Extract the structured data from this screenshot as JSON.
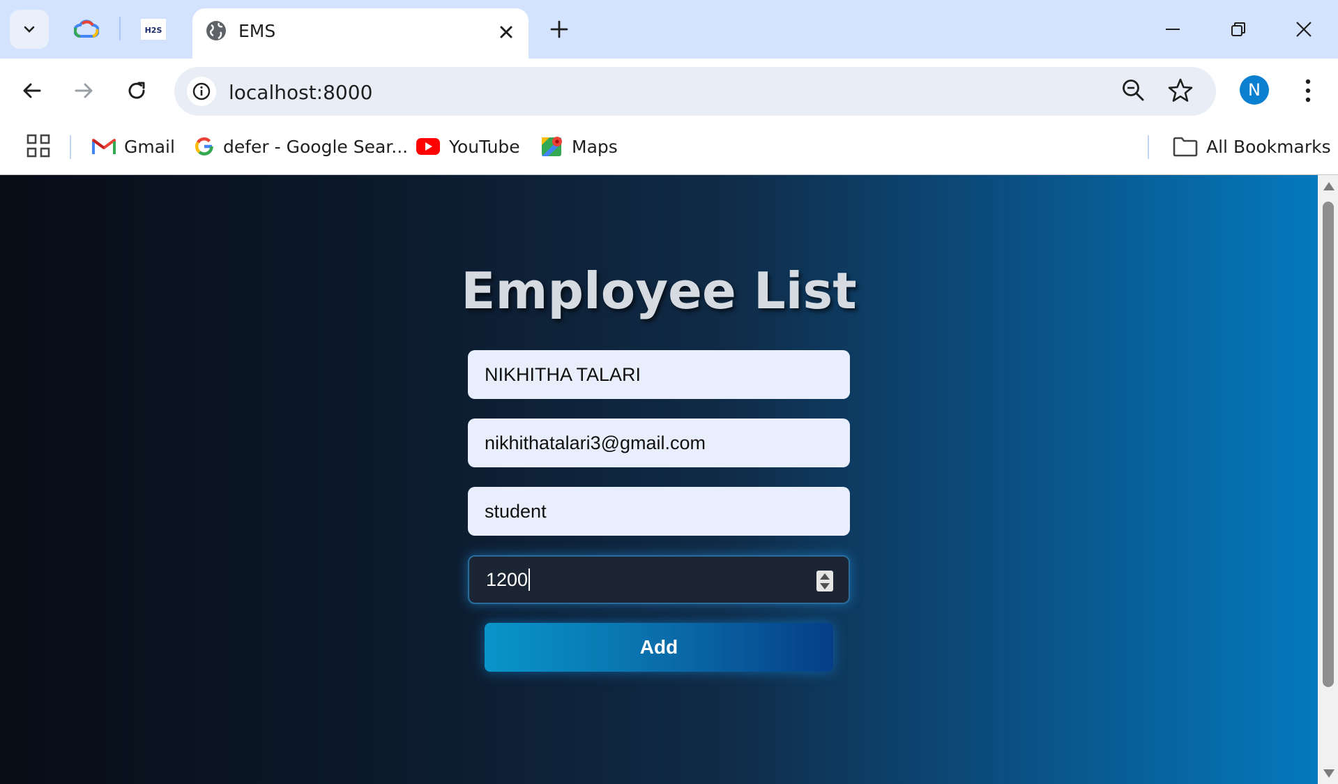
{
  "browser": {
    "active_tab": {
      "title": "EMS"
    },
    "address_bar": {
      "url": "localhost:8000"
    },
    "profile_initial": "N",
    "bookmarks": [
      {
        "label": "Gmail",
        "icon": "gmail-icon"
      },
      {
        "label": "defer - Google Sear...",
        "icon": "google-icon"
      },
      {
        "label": "YouTube",
        "icon": "youtube-icon"
      },
      {
        "label": "Maps",
        "icon": "maps-icon"
      }
    ],
    "all_bookmarks_label": "All Bookmarks"
  },
  "page": {
    "title": "Employee List",
    "form": {
      "name_value": "NIKHITHA TALARI",
      "email_value": "nikhithatalari3@gmail.com",
      "role_value": "student",
      "salary_value": "1200",
      "add_label": "Add"
    }
  },
  "colors": {
    "tabstrip": "#d3e3fd",
    "accent": "#0b7fd0",
    "button_start": "#0895c9",
    "button_end": "#053e86"
  }
}
